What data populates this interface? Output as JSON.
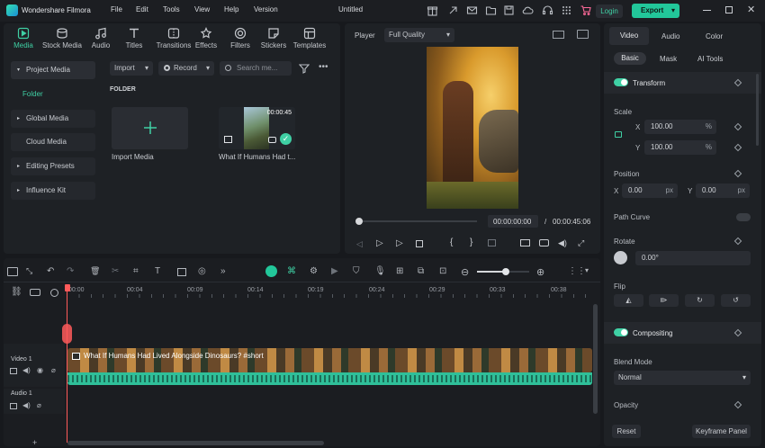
{
  "app": {
    "name": "Wondershare Filmora",
    "doc_title": "Untitled"
  },
  "menu": [
    "File",
    "Edit",
    "Tools",
    "View",
    "Help",
    "Version"
  ],
  "titlebar": {
    "login": "Login",
    "export": "Export"
  },
  "toolbar": [
    {
      "label": "Media",
      "icon": "media-icon"
    },
    {
      "label": "Stock Media",
      "icon": "stock-media-icon"
    },
    {
      "label": "Audio",
      "icon": "audio-icon"
    },
    {
      "label": "Titles",
      "icon": "titles-icon"
    },
    {
      "label": "Transitions",
      "icon": "transitions-icon"
    },
    {
      "label": "Effects",
      "icon": "effects-icon"
    },
    {
      "label": "Filters",
      "icon": "filters-icon"
    },
    {
      "label": "Stickers",
      "icon": "stickers-icon"
    },
    {
      "label": "Templates",
      "icon": "templates-icon"
    }
  ],
  "sidebar": {
    "project_media": "Project Media",
    "folder": "Folder",
    "global_media": "Global Media",
    "cloud_media": "Cloud Media",
    "editing_presets": "Editing Presets",
    "influence_kit": "Influence Kit"
  },
  "media_bar": {
    "import": "Import",
    "record": "Record",
    "search_placeholder": "Search me..."
  },
  "library": {
    "folder_heading": "FOLDER",
    "import_tile": "Import Media",
    "clip_name": "What If Humans Had t...",
    "clip_duration": "00:00:45"
  },
  "player": {
    "label": "Player",
    "quality": "Full Quality",
    "current": "00:00:00:00",
    "separator": "/",
    "total": "00:00:45:06",
    "progress": 0.0
  },
  "props": {
    "tabs": [
      "Video",
      "Audio",
      "Color"
    ],
    "subtabs": [
      "Basic",
      "Mask",
      "AI Tools"
    ],
    "transform": "Transform",
    "scale": "Scale",
    "scale_x": "100.00",
    "scale_y": "100.00",
    "pct": "%",
    "x": "X",
    "y": "Y",
    "position": "Position",
    "pos_x": "0.00",
    "pos_y": "0.00",
    "px": "px",
    "path_curve": "Path Curve",
    "rotate": "Rotate",
    "rotate_val": "0.00°",
    "flip": "Flip",
    "compositing": "Compositing",
    "blend_mode": "Blend Mode",
    "blend_value": "Normal",
    "opacity": "Opacity",
    "reset": "Reset",
    "keyframe": "Keyframe Panel"
  },
  "timeline": {
    "ruler": [
      "00:00",
      "00:04",
      "00:09",
      "00:14",
      "00:19",
      "00:24",
      "00:29",
      "00:33",
      "00:38"
    ],
    "video_track": "Video 1",
    "audio_track": "Audio 1",
    "clip_title": "What If Humans Had Lived Alongside Dinosaurs? #short",
    "zoom": 0.55
  },
  "colors": {
    "accent": "#3fd0a4",
    "brand_green": "#22c79a",
    "playhead": "#ff5a5a",
    "audio": "#2fbf99"
  }
}
